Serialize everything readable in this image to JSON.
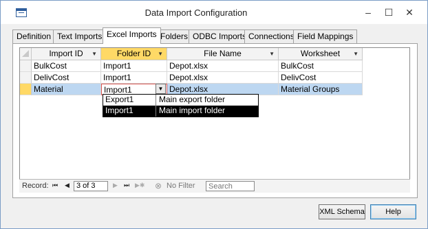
{
  "window": {
    "title": "Data Import Configuration"
  },
  "titlebar_controls": {
    "minimize": "–",
    "maximize": "☐",
    "close": "✕"
  },
  "tabs": [
    {
      "label": "Definition"
    },
    {
      "label": "Text Imports"
    },
    {
      "label": "Excel Imports"
    },
    {
      "label": "Folders"
    },
    {
      "label": "ODBC Imports"
    },
    {
      "label": "Connections"
    },
    {
      "label": "Field Mappings"
    }
  ],
  "active_tab": "Excel Imports",
  "grid": {
    "columns": [
      "Import ID",
      "Folder ID",
      "File Name",
      "Worksheet"
    ],
    "sort_arrow": "▼",
    "rows": [
      {
        "import_id": "BulkCost",
        "folder_id": "Import1",
        "file_name": "Depot.xlsx",
        "worksheet": "BulkCost"
      },
      {
        "import_id": "DelivCost",
        "folder_id": "Import1",
        "file_name": "Depot.xlsx",
        "worksheet": "DelivCost"
      },
      {
        "import_id": "Material",
        "folder_id": "Import1",
        "file_name": "Depot.xlsx",
        "worksheet": "Material Groups"
      }
    ]
  },
  "dropdown": {
    "button_glyph": "▼",
    "options": [
      {
        "id": "Export1",
        "description": "Main export folder"
      },
      {
        "id": "Import1",
        "description": "Main import folder"
      }
    ]
  },
  "navigation": {
    "record_label": "Record:",
    "position": "3 of 3",
    "first_glyph": "⏮",
    "prev_glyph": "◀",
    "next_glyph": "▶",
    "last_glyph": "⏭",
    "new_glyph": "▶✱",
    "filter_glyph": "⊗",
    "filter_label": "No Filter",
    "search_placeholder": "Search"
  },
  "buttons": {
    "xml_schema": "XML Schema",
    "help": "Help"
  }
}
